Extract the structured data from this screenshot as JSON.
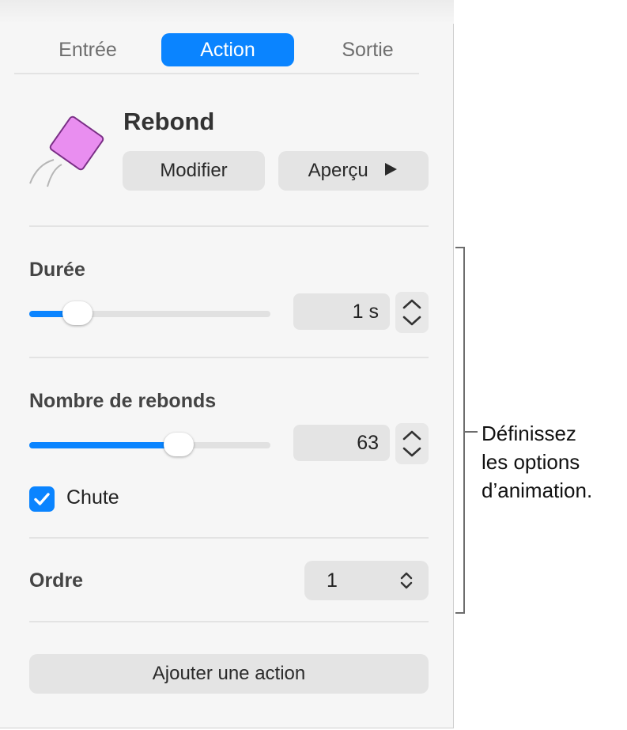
{
  "tabs": [
    {
      "label": "Entrée",
      "active": false
    },
    {
      "label": "Action",
      "active": true
    },
    {
      "label": "Sortie",
      "active": false
    }
  ],
  "animation": {
    "title": "Rebond",
    "edit_label": "Modifier",
    "preview_label": "Aperçu",
    "preview_icon": "play-icon"
  },
  "duration": {
    "label": "Durée",
    "value": "1 s",
    "slider_fraction": 0.2
  },
  "bounces": {
    "label": "Nombre de rebonds",
    "value": "63",
    "slider_fraction": 0.62
  },
  "fall": {
    "label": "Chute",
    "checked": true
  },
  "order": {
    "label": "Ordre",
    "value": "1"
  },
  "add_action_label": "Ajouter une action",
  "callout": {
    "lines": [
      "Définissez",
      "les options",
      "d’animation."
    ]
  },
  "colors": {
    "accent": "#0a84ff",
    "shape_fill": "#e98ef0"
  }
}
